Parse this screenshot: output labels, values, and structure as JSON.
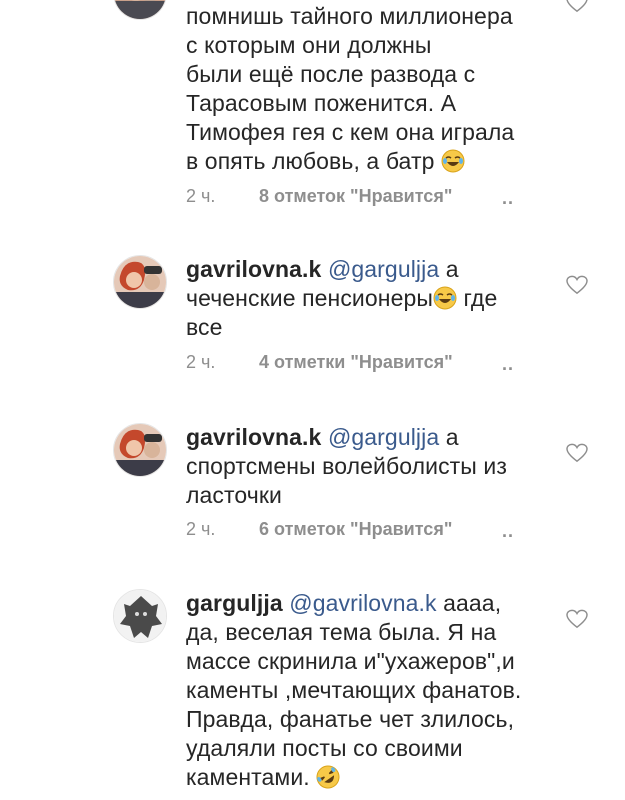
{
  "comments": [
    {
      "id": "c1",
      "username": "",
      "mention": "",
      "lines": [
        "помнишь тайного миллионера",
        "с которым они должны",
        "были ещё после развода с",
        "Тарасовым поженится. А",
        "Тимофея гея с кем она играла",
        "в опять любовь, а батр"
      ],
      "emoji": "tears-of-joy-emoji",
      "time": "2 ч.",
      "likes": "8 отметок \"Нравится\"",
      "more": ".."
    },
    {
      "id": "c2",
      "username": "gavrilovna.k",
      "mention": "@garguljja",
      "first_tail": " а",
      "lines": [
        "чеченские пенсионеры",
        "все"
      ],
      "line1_suffix": " где",
      "emoji": "tears-of-joy-emoji",
      "time": "2 ч.",
      "likes": "4 отметки \"Нравится\"",
      "more": ".."
    },
    {
      "id": "c3",
      "username": "gavrilovna.k",
      "mention": "@garguljja",
      "first_tail": " а",
      "lines": [
        "спортсмены волейболисты из",
        "ласточки"
      ],
      "time": "2 ч.",
      "likes": "6 отметок \"Нравится\"",
      "more": ".."
    },
    {
      "id": "c4",
      "username": "garguljja",
      "mention": "@gavrilovna.k",
      "first_tail": " аааа,",
      "lines": [
        "да, веселая тема была. Я на",
        "массе скринила и\"ухажеров\",и",
        "каменты ,мечтающих фанатов.",
        "Правда, фанатье чет злилось,",
        "удаляли посты со своими",
        "каментами."
      ],
      "emoji": "rofl-emoji"
    }
  ],
  "colors": {
    "text": "#262626",
    "meta": "#8e8e8e",
    "mention": "#3a5a8c",
    "heart_stroke": "#8e8e8e",
    "emoji_face": "#f7c948"
  },
  "icons": {
    "like": "heart-outline-icon",
    "avatar_1": "avatar-photo",
    "avatar_2": "avatar-gargoyle"
  }
}
